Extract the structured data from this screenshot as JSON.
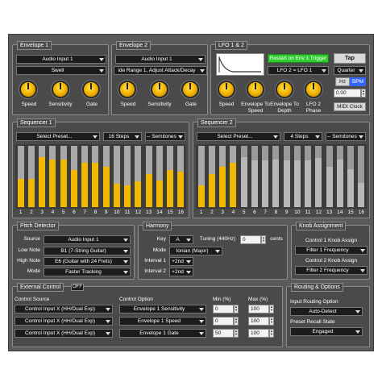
{
  "envelope1": {
    "title": "Envelope 1",
    "input": "Audio Input 1",
    "mode": "Swell",
    "knobs": [
      "Speed",
      "Sensitivity",
      "Gate"
    ]
  },
  "envelope2": {
    "title": "Envelope 2",
    "input": "Audio Input 1",
    "mode": "ide Range 1, Adjust Attack/Decay",
    "knobs": [
      "Speed",
      "Sensitivity",
      "Gate"
    ]
  },
  "lfo": {
    "title": "LFO 1 & 2",
    "restart_button": "Restart on Env 1 Trigger",
    "tap_button": "Tap",
    "link": "LFO 2 = LFO 1",
    "division": "Quarter",
    "hz_label": "Hz",
    "bpm_label": "BPM",
    "rate_value": "0.00",
    "midi_clock": "MIDI Clock",
    "knobs": [
      "Speed",
      "Envelope To Speed",
      "Envelope To Depth",
      "LFO 2 Phase"
    ]
  },
  "sequencer1": {
    "title": "Sequencer 1",
    "preset": "Select Preset...",
    "steps": "16 Steps",
    "semitones": "-- Semitones",
    "step_labels": [
      "1",
      "2",
      "3",
      "4",
      "5",
      "6",
      "7",
      "8",
      "9",
      "10",
      "11",
      "12",
      "13",
      "14",
      "15",
      "16"
    ],
    "values": [
      0.46,
      0.46,
      0.82,
      0.78,
      0.78,
      0.6,
      0.72,
      0.72,
      0.66,
      0.38,
      0.36,
      0.42,
      0.54,
      0.44,
      0.6,
      0.58
    ],
    "active_steps": 16
  },
  "sequencer2": {
    "title": "Sequencer 2",
    "preset": "Select Preset...",
    "steps": "4 Steps",
    "semitones": "-- Semitones",
    "step_labels": [
      "1",
      "2",
      "3",
      "4",
      "5",
      "6",
      "7",
      "8",
      "9",
      "10",
      "11",
      "12",
      "13",
      "14",
      "15",
      "16"
    ],
    "values": [
      0.36,
      0.54,
      0.66,
      0.72,
      0.82,
      0.76,
      0.76,
      0.78,
      0.76,
      0.76,
      0.76,
      0.8,
      0.66,
      0.78,
      0.62,
      0.4
    ],
    "active_steps": 4
  },
  "pitch": {
    "title": "Pitch Detector",
    "source_label": "Source",
    "source": "Audio Input 1",
    "low_label": "Low Note",
    "low": "B1 (7-String Guitar)",
    "high_label": "High Note",
    "high": "E6 (Guitar with 24 Frets)",
    "mode_label": "Mode",
    "mode": "Faster Tracking"
  },
  "harmony": {
    "title": "Harmony",
    "key_label": "Key",
    "key": "A",
    "tuning_label": "Tuning (440Hz)",
    "tuning": "0",
    "cents_label": "cents",
    "mode_label": "Mode",
    "mode": "Ionian (Major)",
    "interval1_label": "Interval 1",
    "interval1": "+2nd",
    "interval2_label": "Interval 2",
    "interval2": "+2nd"
  },
  "knob_assign": {
    "title": "Knob Assignment",
    "c1_label": "Control 1 Knob Assign",
    "c1": "Filter 1 Frequency",
    "c2_label": "Control 2 Knob Assign",
    "c2": "Filter 2 Frequency"
  },
  "external": {
    "title": "External Control",
    "toggle": "OFF",
    "source_header": "Control Source",
    "option_header": "Control Option",
    "min_header": "Min (%)",
    "max_header": "Max (%)",
    "rows": [
      {
        "source": "Control Input X (HH/Dual Exp)",
        "option": "Envelope 1 Sensitivity",
        "min": "0",
        "max": "100"
      },
      {
        "source": "Control Input X (HH/Dual Exp)",
        "option": "Envelope 1 Speed",
        "min": "0",
        "max": "100"
      },
      {
        "source": "Control Input X (HH/Dual Exp)",
        "option": "Envelope 1 Gate",
        "min": "50",
        "max": "100"
      }
    ]
  },
  "routing": {
    "title": "Routing & Options",
    "input_label": "Input Routing Option",
    "input": "Auto-Detect",
    "preset_label": "Preset Recall State",
    "preset": "Engaged"
  }
}
